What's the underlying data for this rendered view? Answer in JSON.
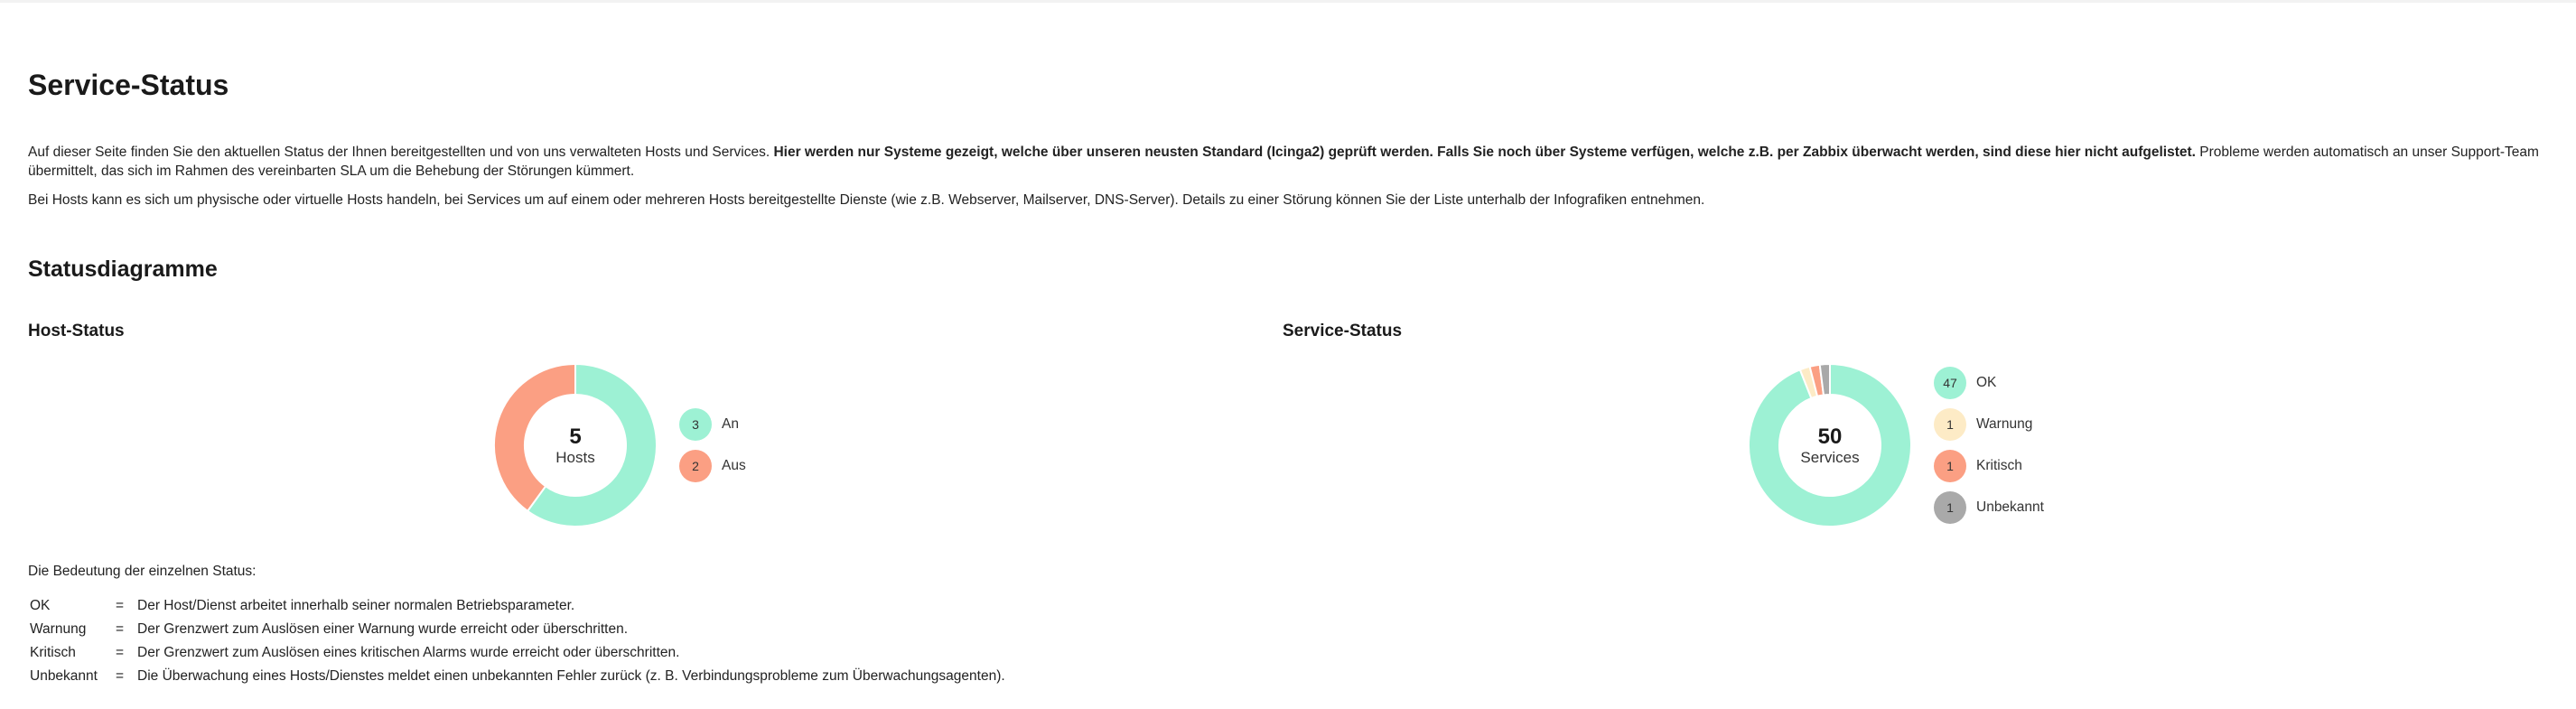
{
  "page": {
    "title": "Service-Status",
    "intro": {
      "part1": "Auf dieser Seite finden Sie den aktuellen Status der Ihnen bereitgestellten und von uns verwalteten Hosts und Services. ",
      "bold": "Hier werden nur Systeme gezeigt, welche über unseren neusten Standard (Icinga2) geprüft werden. Falls Sie noch über Systeme verfügen, welche z.B. per Zabbix überwacht werden, sind diese hier nicht aufgelistet.",
      "part2": " Probleme werden automatisch an unser Support-Team übermittelt, das sich im Rahmen des vereinbarten SLA um die Behebung der Störungen kümmert."
    },
    "intro2": "Bei Hosts kann es sich um physische oder virtuelle Hosts handeln, bei Services um auf einem oder mehreren Hosts bereitgestellte Dienste (wie z.B. Webserver, Mailserver, DNS-Server). Details zu einer Störung können Sie der Liste unterhalb der Infografiken entnehmen."
  },
  "diagrams": {
    "title": "Statusdiagramme"
  },
  "host_status": {
    "title": "Host-Status",
    "total": "5",
    "total_label": "Hosts",
    "legend": [
      {
        "count": "3",
        "label": "An",
        "color": "#9df1d4"
      },
      {
        "count": "2",
        "label": "Aus",
        "color": "#fb9f83"
      }
    ]
  },
  "service_status": {
    "title": "Service-Status",
    "total": "50",
    "total_label": "Services",
    "legend": [
      {
        "count": "47",
        "label": "OK",
        "color": "#9df1d4"
      },
      {
        "count": "1",
        "label": "Warnung",
        "color": "#fdebc6"
      },
      {
        "count": "1",
        "label": "Kritisch",
        "color": "#fb9f83"
      },
      {
        "count": "1",
        "label": "Unbekannt",
        "color": "#a9a9a9"
      }
    ]
  },
  "chart_data": [
    {
      "type": "pie",
      "title": "Host-Status",
      "categories": [
        "An",
        "Aus"
      ],
      "values": [
        3,
        2
      ],
      "colors": [
        "#9df1d4",
        "#fb9f83"
      ],
      "center_value": 5,
      "center_label": "Hosts"
    },
    {
      "type": "pie",
      "title": "Service-Status",
      "categories": [
        "OK",
        "Warnung",
        "Kritisch",
        "Unbekannt"
      ],
      "values": [
        47,
        1,
        1,
        1
      ],
      "colors": [
        "#9df1d4",
        "#fdebc6",
        "#fb9f83",
        "#a9a9a9"
      ],
      "center_value": 50,
      "center_label": "Services"
    }
  ],
  "meanings": {
    "intro": "Die Bedeutung der einzelnen Status:",
    "rows": [
      {
        "key": "OK",
        "eq": "=",
        "desc": "Der Host/Dienst arbeitet innerhalb seiner normalen Betriebsparameter."
      },
      {
        "key": "Warnung",
        "eq": "=",
        "desc": "Der Grenzwert zum Auslösen einer Warnung wurde erreicht oder überschritten."
      },
      {
        "key": "Kritisch",
        "eq": "=",
        "desc": "Der Grenzwert zum Auslösen eines kritischen Alarms wurde erreicht oder überschritten."
      },
      {
        "key": "Unbekannt",
        "eq": "=",
        "desc": "Die Überwachung eines Hosts/Dienstes meldet einen unbekannten Fehler zurück (z. B. Verbindungsprobleme zum Überwachungsagenten)."
      }
    ]
  }
}
